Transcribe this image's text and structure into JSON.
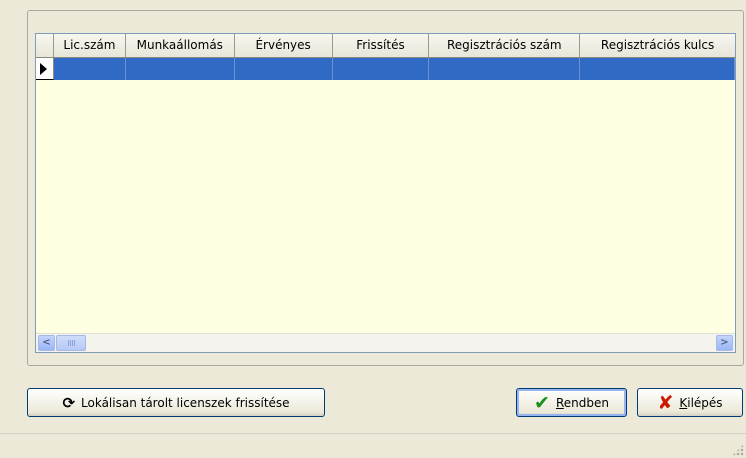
{
  "grid": {
    "columns": [
      "Lic.szám",
      "Munkaállomás",
      "Érvényes",
      "Frissítés",
      "Regisztrációs szám",
      "Regisztrációs kulcs"
    ],
    "scroll_left_glyph": "<",
    "scroll_right_glyph": ">"
  },
  "buttons": {
    "refresh_label": "Lokálisan tárolt licenszek frissítése",
    "ok_accel": "R",
    "ok_rest": "endben",
    "exit_accel": "K",
    "exit_rest": "ilépés"
  },
  "icons": {
    "refresh": "refresh-icon",
    "ok": "check-icon",
    "exit": "cross-icon"
  },
  "colors": {
    "selection": "#316ac5",
    "grid_background": "#ffffe1",
    "window": "#ece9d8"
  }
}
